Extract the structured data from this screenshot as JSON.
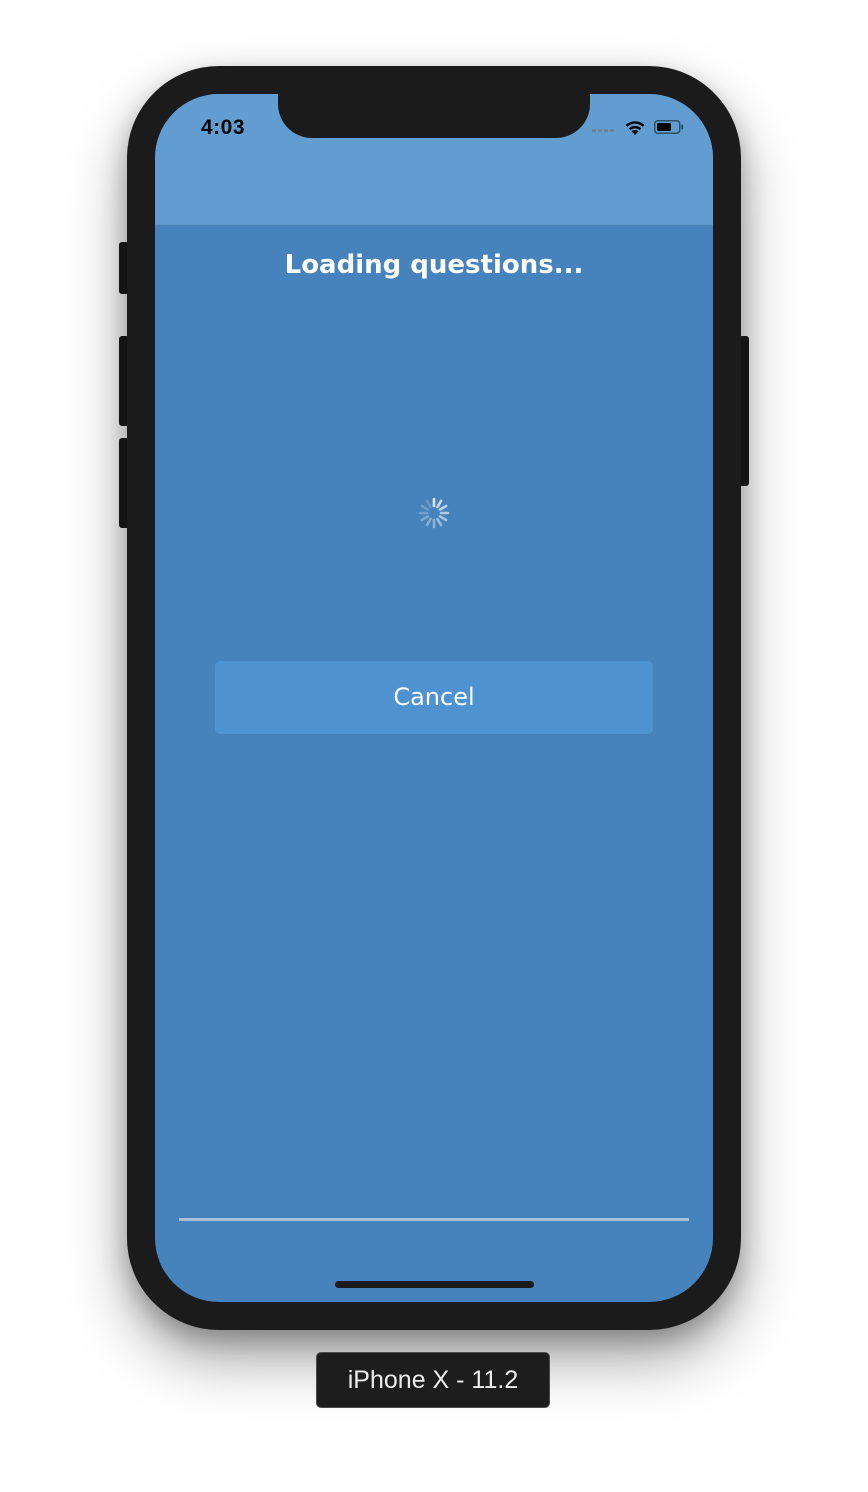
{
  "status_bar": {
    "time": "4:03",
    "icons": [
      "cellular-signal-icon",
      "wifi-icon",
      "battery-icon"
    ]
  },
  "screen": {
    "title": "Loading questions...",
    "spinner_icon": "activity-spinner-icon",
    "cancel_label": "Cancel"
  },
  "device_label": "iPhone X - 11.2",
  "colors": {
    "navbar": "#619dd0",
    "background": "#4682bb",
    "button": "#4e93d0",
    "text": "#ffffff",
    "device_frame": "#1b1b1b"
  }
}
